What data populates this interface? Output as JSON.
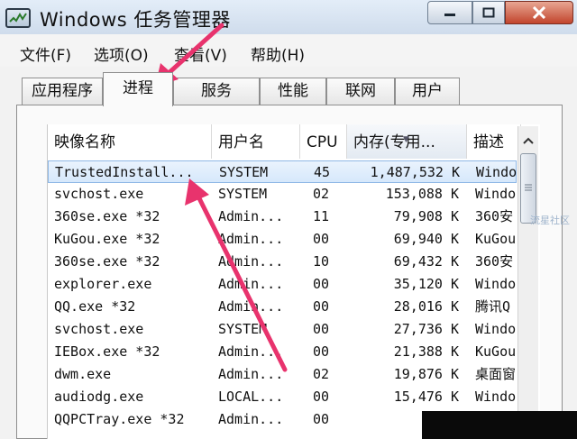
{
  "window": {
    "title": "Windows 任务管理器",
    "buttons": {
      "minimize_icon": "minimize-icon",
      "maximize_icon": "maximize-icon",
      "close_icon": "close-icon"
    }
  },
  "menu": [
    "文件(F)",
    "选项(O)",
    "查看(V)",
    "帮助(H)"
  ],
  "tabs": [
    "应用程序",
    "进程",
    "服务",
    "性能",
    "联网",
    "用户"
  ],
  "active_tab": "进程",
  "columns": [
    "映像名称",
    "用户名",
    "CPU",
    "内存(专用...",
    "描述"
  ],
  "processes": [
    {
      "name": "TrustedInstall...",
      "user": "SYSTEM",
      "cpu": "45",
      "mem": "1,487,532 K",
      "desc": "Windo"
    },
    {
      "name": "svchost.exe",
      "user": "SYSTEM",
      "cpu": "02",
      "mem": "153,088 K",
      "desc": "Windo"
    },
    {
      "name": "360se.exe *32",
      "user": "Admin...",
      "cpu": "11",
      "mem": "79,908 K",
      "desc": "360安"
    },
    {
      "name": "KuGou.exe *32",
      "user": "Admin...",
      "cpu": "00",
      "mem": "69,940 K",
      "desc": "KuGou"
    },
    {
      "name": "360se.exe *32",
      "user": "Admin...",
      "cpu": "10",
      "mem": "69,432 K",
      "desc": "360安"
    },
    {
      "name": "explorer.exe",
      "user": "Admin...",
      "cpu": "00",
      "mem": "35,120 K",
      "desc": "Windo"
    },
    {
      "name": "QQ.exe *32",
      "user": "Admin...",
      "cpu": "00",
      "mem": "28,016 K",
      "desc": "腾讯Q"
    },
    {
      "name": "svchost.exe",
      "user": "SYSTEM",
      "cpu": "00",
      "mem": "27,736 K",
      "desc": "Windo"
    },
    {
      "name": "IEBox.exe *32",
      "user": "Admin...",
      "cpu": "00",
      "mem": "21,388 K",
      "desc": "KuGou"
    },
    {
      "name": "dwm.exe",
      "user": "Admin...",
      "cpu": "02",
      "mem": "19,876 K",
      "desc": "桌面窗"
    },
    {
      "name": "audiodg.exe",
      "user": "LOCAL...",
      "cpu": "00",
      "mem": "15,476 K",
      "desc": "Windo"
    },
    {
      "name": "QQPCTray.exe *32",
      "user": "Admin...",
      "cpu": "00",
      "mem": "",
      "desc": ""
    }
  ],
  "selected_row": 0,
  "watermark": "流星社区",
  "colors": {
    "annotation_arrow": "#e8336d",
    "selection": "#d6e8fb",
    "close_button": "#c2452d"
  }
}
